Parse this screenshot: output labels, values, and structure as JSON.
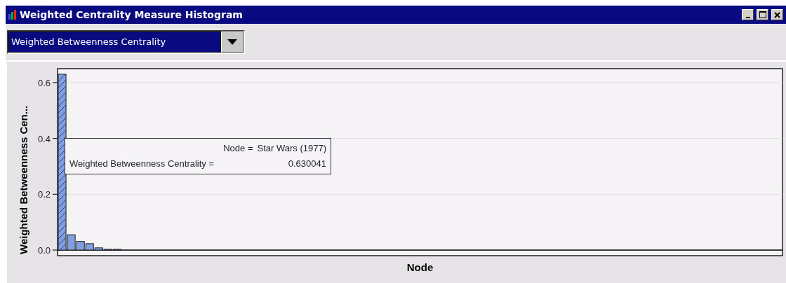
{
  "window": {
    "title": "Weighted Centrality Measure Histogram"
  },
  "measure_dropdown": {
    "value": "Weighted Betweenness Centrality"
  },
  "histogram": {
    "chart_data": {
      "type": "bar",
      "xlabel": "Node",
      "ylabel": "Weighted Betweenness Cen...",
      "ylim": [
        0,
        0.65
      ],
      "grid": true,
      "yticks": [
        {
          "value": 0,
          "label": "0.0"
        },
        {
          "value": 0.2,
          "label": "0.2"
        },
        {
          "value": 0.4,
          "label": "0.4"
        },
        {
          "value": 0.6,
          "label": "0.6"
        }
      ],
      "categories": [
        null,
        null,
        null,
        null,
        null,
        null,
        null,
        null,
        null,
        null,
        null,
        null,
        null,
        null,
        null,
        null,
        null,
        null,
        null,
        null,
        null,
        null,
        null,
        null,
        null,
        null,
        null,
        null,
        null,
        null,
        null,
        null,
        null,
        null,
        null,
        null,
        null,
        null,
        null,
        null,
        null,
        null,
        null,
        null,
        null,
        null,
        null,
        null,
        null,
        null,
        null,
        null,
        null,
        null,
        null,
        null,
        null,
        null,
        null,
        null,
        null,
        null,
        null,
        null,
        null,
        null,
        null,
        null,
        null,
        null,
        null,
        null,
        null,
        null,
        null,
        null,
        null,
        null,
        null
      ],
      "series": [
        {
          "color": "#7f9fe0",
          "values": [
            0.63,
            0.055,
            0.031,
            0.023,
            0.008,
            0.003,
            0.003,
            0,
            0,
            0,
            0,
            0,
            0,
            0,
            0,
            0,
            0,
            0,
            0,
            0,
            0,
            0,
            0,
            0,
            0,
            0,
            0,
            0,
            0,
            0,
            0,
            0,
            0,
            0,
            0,
            0,
            0,
            0,
            0,
            0,
            0,
            0,
            0,
            0,
            0,
            0,
            0,
            0,
            0,
            0,
            0,
            0,
            0,
            0,
            0,
            0,
            0,
            0,
            0,
            0,
            0,
            0,
            0,
            0,
            0,
            0,
            0,
            0,
            0,
            0,
            0,
            0,
            0,
            0,
            0,
            0,
            0,
            0,
            0
          ]
        }
      ]
    },
    "bars": [
      {
        "hovered": true
      },
      {
        "hovered": false
      },
      {
        "hovered": false
      },
      {
        "hovered": false
      }
    ],
    "tooltip": {
      "lines": [
        {
          "label": "Node =",
          "value": "Star Wars (1977)"
        },
        {
          "label": "Weighted Betweenness Centrality =",
          "value": "0.630041"
        }
      ]
    }
  }
}
